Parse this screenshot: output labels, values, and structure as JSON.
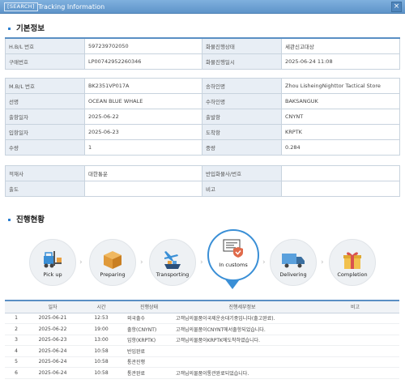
{
  "window": {
    "badge": "[SEARCH]",
    "title": "Tracking Information",
    "close": "×"
  },
  "basic": {
    "heading": "기본정보",
    "rows1": [
      [
        "H.B/L 번호",
        "597239702050",
        "화물진행상태",
        "세관신고대상"
      ],
      [
        "구매번호",
        "LP00742952260346",
        "화물진행일시",
        "2025-06-24 11:08"
      ]
    ],
    "rows2": [
      [
        "M.B/L 번호",
        "BK2351VP017A",
        "송하인명",
        "Zhou LisheingNighttor Tactical Store"
      ],
      [
        "선명",
        "OCEAN BLUE WHALE",
        "수하인명",
        "BAKSANGUK"
      ],
      [
        "출항일자",
        "2025-06-22",
        "출발항",
        "CNYNT"
      ],
      [
        "입항일자",
        "2025-06-23",
        "도착항",
        "KRPTK"
      ],
      [
        "수량",
        "1",
        "중량",
        "0.284"
      ]
    ],
    "rows3": [
      [
        "적재사",
        "대한통운",
        "반입화물사/번호",
        ""
      ],
      [
        "출도",
        "",
        "비고",
        ""
      ]
    ]
  },
  "progress": {
    "heading": "진행현황",
    "steps": [
      {
        "label": "Pick up",
        "icon": "forklift-icon"
      },
      {
        "label": "Preparing",
        "icon": "boxes-icon"
      },
      {
        "label": "Transporting",
        "icon": "plane-ship-icon"
      },
      {
        "label": "In customs",
        "icon": "customs-document-icon"
      },
      {
        "label": "Delivering",
        "icon": "truck-icon"
      },
      {
        "label": "Completion",
        "icon": "gift-box-icon"
      }
    ],
    "active_index": 3
  },
  "history": {
    "headers": [
      "",
      "일자",
      "시간",
      "진행상태",
      "진행세부정보",
      "비고"
    ],
    "rows": [
      [
        "1",
        "2025-06-21",
        "12:53",
        "외국출수",
        "고객님의물품이국제운송대기중입니다(출고완료).",
        ""
      ],
      [
        "2",
        "2025-06-22",
        "19:00",
        "출항(CNYNT)",
        "고객님의물품이CNYNT에서출항되었습니다.",
        ""
      ],
      [
        "3",
        "2025-06-23",
        "13:00",
        "입항(KRPTK)",
        "고객님의물품이KRPTK에도착하였습니다.",
        ""
      ],
      [
        "4",
        "2025-06-24",
        "10:58",
        "반입완료",
        "",
        ""
      ],
      [
        "5",
        "2025-06-24",
        "10:58",
        "통관진행",
        "",
        ""
      ],
      [
        "6",
        "2025-06-24",
        "10:58",
        "통관완료",
        "고객님의물품이통관완료되었습니다.",
        ""
      ]
    ]
  },
  "colors": {
    "accent": "#3a8fd6",
    "titlebar": "#6aa2d6",
    "label_bg": "#e8eef5"
  }
}
